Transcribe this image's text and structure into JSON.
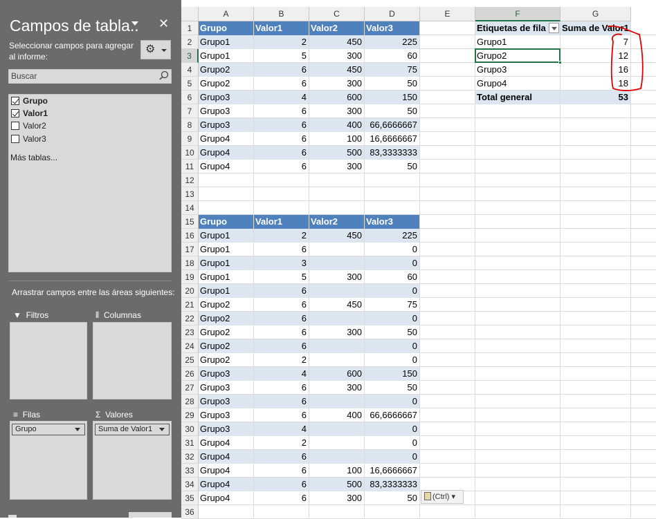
{
  "pane": {
    "title": "Campos de tabla..",
    "subtitle": "Seleccionar campos para agregar al informe:",
    "search_placeholder": "Buscar",
    "fields": [
      {
        "label": "Grupo",
        "checked": true
      },
      {
        "label": "Valor1",
        "checked": true
      },
      {
        "label": "Valor2",
        "checked": false
      },
      {
        "label": "Valor3",
        "checked": false
      }
    ],
    "more_tables": "Más tablas...",
    "drag_hint": "Arrastrar campos entre las áreas siguientes:",
    "areas": {
      "filters": "Filtros",
      "columns": "Columnas",
      "rows": "Filas",
      "values": "Valores"
    },
    "rows_chip": "Grupo",
    "values_chip": "Suma de Valor1"
  },
  "sheet": {
    "columns": [
      "A",
      "B",
      "C",
      "D",
      "E",
      "F",
      "G"
    ],
    "selected_column": "F",
    "selected_row": "3",
    "row_numbers": [
      "1",
      "2",
      "3",
      "4",
      "5",
      "6",
      "7",
      "8",
      "9",
      "10",
      "11",
      "12",
      "13",
      "14",
      "15",
      "16",
      "17",
      "18",
      "19",
      "20",
      "21",
      "22",
      "23",
      "24",
      "25",
      "26",
      "27",
      "28",
      "29",
      "30",
      "31",
      "32",
      "33",
      "34",
      "35",
      "36"
    ],
    "table1": {
      "headers": [
        "Grupo",
        "Valor1",
        "Valor2",
        "Valor3"
      ],
      "rows": [
        [
          "Grupo1",
          "2",
          "450",
          "225"
        ],
        [
          "Grupo1",
          "5",
          "300",
          "60"
        ],
        [
          "Grupo2",
          "6",
          "450",
          "75"
        ],
        [
          "Grupo2",
          "6",
          "300",
          "50"
        ],
        [
          "Grupo3",
          "4",
          "600",
          "150"
        ],
        [
          "Grupo3",
          "6",
          "300",
          "50"
        ],
        [
          "Grupo3",
          "6",
          "400",
          "66,6666667"
        ],
        [
          "Grupo4",
          "6",
          "100",
          "16,6666667"
        ],
        [
          "Grupo4",
          "6",
          "500",
          "83,3333333"
        ],
        [
          "Grupo4",
          "6",
          "300",
          "50"
        ]
      ]
    },
    "table2": {
      "headers": [
        "Grupo",
        "Valor1",
        "Valor2",
        "Valor3"
      ],
      "rows": [
        [
          "Grupo1",
          "2",
          "450",
          "225"
        ],
        [
          "Grupo1",
          "6",
          "",
          "0"
        ],
        [
          "Grupo1",
          "3",
          "",
          "0"
        ],
        [
          "Grupo1",
          "5",
          "300",
          "60"
        ],
        [
          "Grupo1",
          "6",
          "",
          "0"
        ],
        [
          "Grupo2",
          "6",
          "450",
          "75"
        ],
        [
          "Grupo2",
          "6",
          "",
          "0"
        ],
        [
          "Grupo2",
          "6",
          "300",
          "50"
        ],
        [
          "Grupo2",
          "6",
          "",
          "0"
        ],
        [
          "Grupo2",
          "2",
          "",
          "0"
        ],
        [
          "Grupo3",
          "4",
          "600",
          "150"
        ],
        [
          "Grupo3",
          "6",
          "300",
          "50"
        ],
        [
          "Grupo3",
          "6",
          "",
          "0"
        ],
        [
          "Grupo3",
          "6",
          "400",
          "66,6666667"
        ],
        [
          "Grupo3",
          "4",
          "",
          "0"
        ],
        [
          "Grupo4",
          "2",
          "",
          "0"
        ],
        [
          "Grupo4",
          "6",
          "",
          "0"
        ],
        [
          "Grupo4",
          "6",
          "100",
          "16,6666667"
        ],
        [
          "Grupo4",
          "6",
          "500",
          "83,3333333"
        ],
        [
          "Grupo4",
          "6",
          "300",
          "50"
        ]
      ]
    },
    "pivot": {
      "header_row_label": "Etiquetas de fila",
      "header_value": "Suma de Valor1",
      "rows": [
        [
          "Grupo1",
          "7"
        ],
        [
          "Grupo2",
          "12"
        ],
        [
          "Grupo3",
          "16"
        ],
        [
          "Grupo4",
          "18"
        ]
      ],
      "total_label": "Total general",
      "total_value": "53"
    },
    "paste_options": "(Ctrl)",
    "annotation_color": "#e00000"
  },
  "colors": {
    "pane_bg": "#6b6b6b",
    "table_header": "#4f81bd",
    "band": "#dce6f1",
    "selection": "#217346"
  },
  "icons": [
    "close-icon",
    "gear-icon",
    "search-icon",
    "checkbox-icon",
    "filter-icon",
    "columns-icon",
    "rows-icon",
    "sigma-icon",
    "dropdown-arrow-icon",
    "paste-icon"
  ]
}
